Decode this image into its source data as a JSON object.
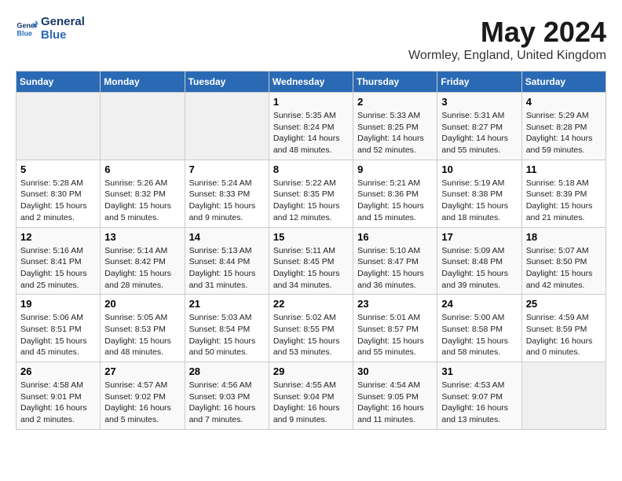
{
  "logo": {
    "line1": "General",
    "line2": "Blue"
  },
  "title": "May 2024",
  "location": "Wormley, England, United Kingdom",
  "weekdays": [
    "Sunday",
    "Monday",
    "Tuesday",
    "Wednesday",
    "Thursday",
    "Friday",
    "Saturday"
  ],
  "weeks": [
    [
      {
        "day": "",
        "info": ""
      },
      {
        "day": "",
        "info": ""
      },
      {
        "day": "",
        "info": ""
      },
      {
        "day": "1",
        "info": "Sunrise: 5:35 AM\nSunset: 8:24 PM\nDaylight: 14 hours\nand 48 minutes."
      },
      {
        "day": "2",
        "info": "Sunrise: 5:33 AM\nSunset: 8:25 PM\nDaylight: 14 hours\nand 52 minutes."
      },
      {
        "day": "3",
        "info": "Sunrise: 5:31 AM\nSunset: 8:27 PM\nDaylight: 14 hours\nand 55 minutes."
      },
      {
        "day": "4",
        "info": "Sunrise: 5:29 AM\nSunset: 8:28 PM\nDaylight: 14 hours\nand 59 minutes."
      }
    ],
    [
      {
        "day": "5",
        "info": "Sunrise: 5:28 AM\nSunset: 8:30 PM\nDaylight: 15 hours\nand 2 minutes."
      },
      {
        "day": "6",
        "info": "Sunrise: 5:26 AM\nSunset: 8:32 PM\nDaylight: 15 hours\nand 5 minutes."
      },
      {
        "day": "7",
        "info": "Sunrise: 5:24 AM\nSunset: 8:33 PM\nDaylight: 15 hours\nand 9 minutes."
      },
      {
        "day": "8",
        "info": "Sunrise: 5:22 AM\nSunset: 8:35 PM\nDaylight: 15 hours\nand 12 minutes."
      },
      {
        "day": "9",
        "info": "Sunrise: 5:21 AM\nSunset: 8:36 PM\nDaylight: 15 hours\nand 15 minutes."
      },
      {
        "day": "10",
        "info": "Sunrise: 5:19 AM\nSunset: 8:38 PM\nDaylight: 15 hours\nand 18 minutes."
      },
      {
        "day": "11",
        "info": "Sunrise: 5:18 AM\nSunset: 8:39 PM\nDaylight: 15 hours\nand 21 minutes."
      }
    ],
    [
      {
        "day": "12",
        "info": "Sunrise: 5:16 AM\nSunset: 8:41 PM\nDaylight: 15 hours\nand 25 minutes."
      },
      {
        "day": "13",
        "info": "Sunrise: 5:14 AM\nSunset: 8:42 PM\nDaylight: 15 hours\nand 28 minutes."
      },
      {
        "day": "14",
        "info": "Sunrise: 5:13 AM\nSunset: 8:44 PM\nDaylight: 15 hours\nand 31 minutes."
      },
      {
        "day": "15",
        "info": "Sunrise: 5:11 AM\nSunset: 8:45 PM\nDaylight: 15 hours\nand 34 minutes."
      },
      {
        "day": "16",
        "info": "Sunrise: 5:10 AM\nSunset: 8:47 PM\nDaylight: 15 hours\nand 36 minutes."
      },
      {
        "day": "17",
        "info": "Sunrise: 5:09 AM\nSunset: 8:48 PM\nDaylight: 15 hours\nand 39 minutes."
      },
      {
        "day": "18",
        "info": "Sunrise: 5:07 AM\nSunset: 8:50 PM\nDaylight: 15 hours\nand 42 minutes."
      }
    ],
    [
      {
        "day": "19",
        "info": "Sunrise: 5:06 AM\nSunset: 8:51 PM\nDaylight: 15 hours\nand 45 minutes."
      },
      {
        "day": "20",
        "info": "Sunrise: 5:05 AM\nSunset: 8:53 PM\nDaylight: 15 hours\nand 48 minutes."
      },
      {
        "day": "21",
        "info": "Sunrise: 5:03 AM\nSunset: 8:54 PM\nDaylight: 15 hours\nand 50 minutes."
      },
      {
        "day": "22",
        "info": "Sunrise: 5:02 AM\nSunset: 8:55 PM\nDaylight: 15 hours\nand 53 minutes."
      },
      {
        "day": "23",
        "info": "Sunrise: 5:01 AM\nSunset: 8:57 PM\nDaylight: 15 hours\nand 55 minutes."
      },
      {
        "day": "24",
        "info": "Sunrise: 5:00 AM\nSunset: 8:58 PM\nDaylight: 15 hours\nand 58 minutes."
      },
      {
        "day": "25",
        "info": "Sunrise: 4:59 AM\nSunset: 8:59 PM\nDaylight: 16 hours\nand 0 minutes."
      }
    ],
    [
      {
        "day": "26",
        "info": "Sunrise: 4:58 AM\nSunset: 9:01 PM\nDaylight: 16 hours\nand 2 minutes."
      },
      {
        "day": "27",
        "info": "Sunrise: 4:57 AM\nSunset: 9:02 PM\nDaylight: 16 hours\nand 5 minutes."
      },
      {
        "day": "28",
        "info": "Sunrise: 4:56 AM\nSunset: 9:03 PM\nDaylight: 16 hours\nand 7 minutes."
      },
      {
        "day": "29",
        "info": "Sunrise: 4:55 AM\nSunset: 9:04 PM\nDaylight: 16 hours\nand 9 minutes."
      },
      {
        "day": "30",
        "info": "Sunrise: 4:54 AM\nSunset: 9:05 PM\nDaylight: 16 hours\nand 11 minutes."
      },
      {
        "day": "31",
        "info": "Sunrise: 4:53 AM\nSunset: 9:07 PM\nDaylight: 16 hours\nand 13 minutes."
      },
      {
        "day": "",
        "info": ""
      }
    ]
  ]
}
